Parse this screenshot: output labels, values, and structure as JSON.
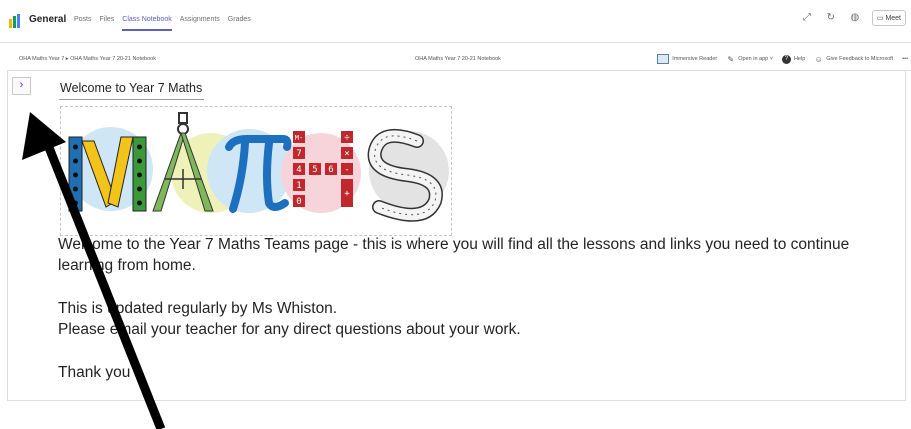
{
  "teams": {
    "channel_name": "General",
    "tabs": [
      "Posts",
      "Files",
      "Class Notebook",
      "Assignments",
      "Grades"
    ],
    "active_tab": "Class Notebook",
    "meet_label": "Meet"
  },
  "onenote": {
    "breadcrumb": "OHA Maths Year 7 ▸ OHA Maths Year 7 20-21 Notebook",
    "notebook_title": "OHA Maths Year 7 20-21 Notebook",
    "actions": {
      "immersive_reader": "Immersive Reader",
      "open_in_app": "Open in app ˅",
      "help": "Help",
      "give_feedback": "Give Feedback to Microsoft",
      "more": "•••"
    },
    "nav_toggle": "›"
  },
  "page": {
    "title": "Welcome to Year 7 Maths",
    "maths_image": {
      "letters": [
        "M",
        "A",
        "π",
        "H",
        "S"
      ],
      "calc_keys": [
        "M-",
        "7",
        "4",
        "5",
        "6",
        "1",
        "0",
        "÷",
        "×",
        "-",
        "+"
      ]
    },
    "lines": [
      "Welcome to the Year 7 Maths Teams page - this is where you will find all the lessons and links you need to continue",
      "learning from home.",
      "This is updated regularly by Ms Whiston.",
      "Please email your teacher for any direct questions about your work.",
      "Thank you"
    ]
  },
  "colors": {
    "accent": "#5b5fc7",
    "onenote_purple": "#7719aa",
    "circle_blue": "#cfe6f7",
    "circle_yellow": "#eef2b8",
    "circle_pink": "#f7d3da",
    "circle_grey": "#e3e3e3"
  }
}
